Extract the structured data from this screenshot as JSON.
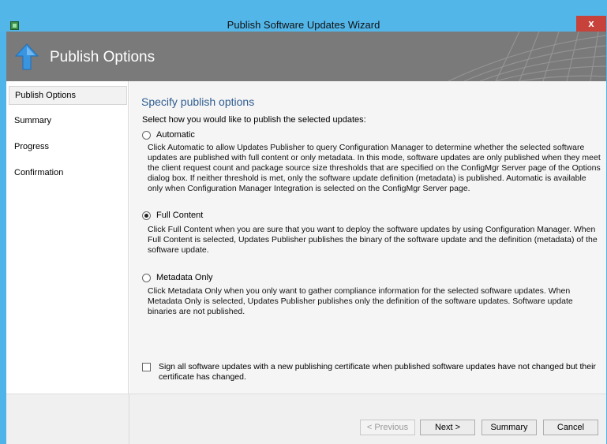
{
  "window": {
    "title": "Publish Software Updates Wizard",
    "close_glyph": "x"
  },
  "banner": {
    "title": "Publish Options",
    "icon": "up-arrow-icon"
  },
  "nav": {
    "items": [
      {
        "label": "Publish Options",
        "selected": true
      },
      {
        "label": "Summary",
        "selected": false
      },
      {
        "label": "Progress",
        "selected": false
      },
      {
        "label": "Confirmation",
        "selected": false
      }
    ]
  },
  "content": {
    "title": "Specify publish options",
    "instruction": "Select how you would like to publish the selected updates:",
    "options": [
      {
        "label": "Automatic",
        "checked": false,
        "description": "Click Automatic to allow Updates Publisher to query  Configuration Manager to determine whether the selected software updates are published with full content or only metadata. In this mode, software updates are only published when they meet the client request count and package source size thresholds that are specified on the ConfigMgr Server page of the Options dialog box. If neither threshold is met, only the software update definition (metadata) is published. Automatic is available only when Configuration Manager Integration is selected on the ConfigMgr Server page."
      },
      {
        "label": "Full Content",
        "checked": true,
        "description": "Click Full Content when you are sure that you want to deploy the software updates by using Configuration Manager. When Full Content is selected, Updates Publisher publishes the binary of the software update and the definition (metadata) of the software update."
      },
      {
        "label": "Metadata Only",
        "checked": false,
        "description": "Click Metadata Only when you only want to gather compliance information for the selected software updates. When Metadata Only is selected, Updates Publisher publishes only the definition of the software updates. Software update binaries are not published."
      }
    ],
    "sign_checkbox": {
      "checked": false,
      "label": "Sign all software updates with a new publishing certificate when published software updates have not changed but their certificate has changed."
    }
  },
  "footer": {
    "previous_label": "< Previous",
    "next_label": "Next >",
    "summary_label": "Summary",
    "cancel_label": "Cancel"
  },
  "colors": {
    "titlebar": "#53b6e9",
    "close": "#c7423b",
    "banner": "#7a7a7a",
    "section_title": "#2f5d91"
  }
}
